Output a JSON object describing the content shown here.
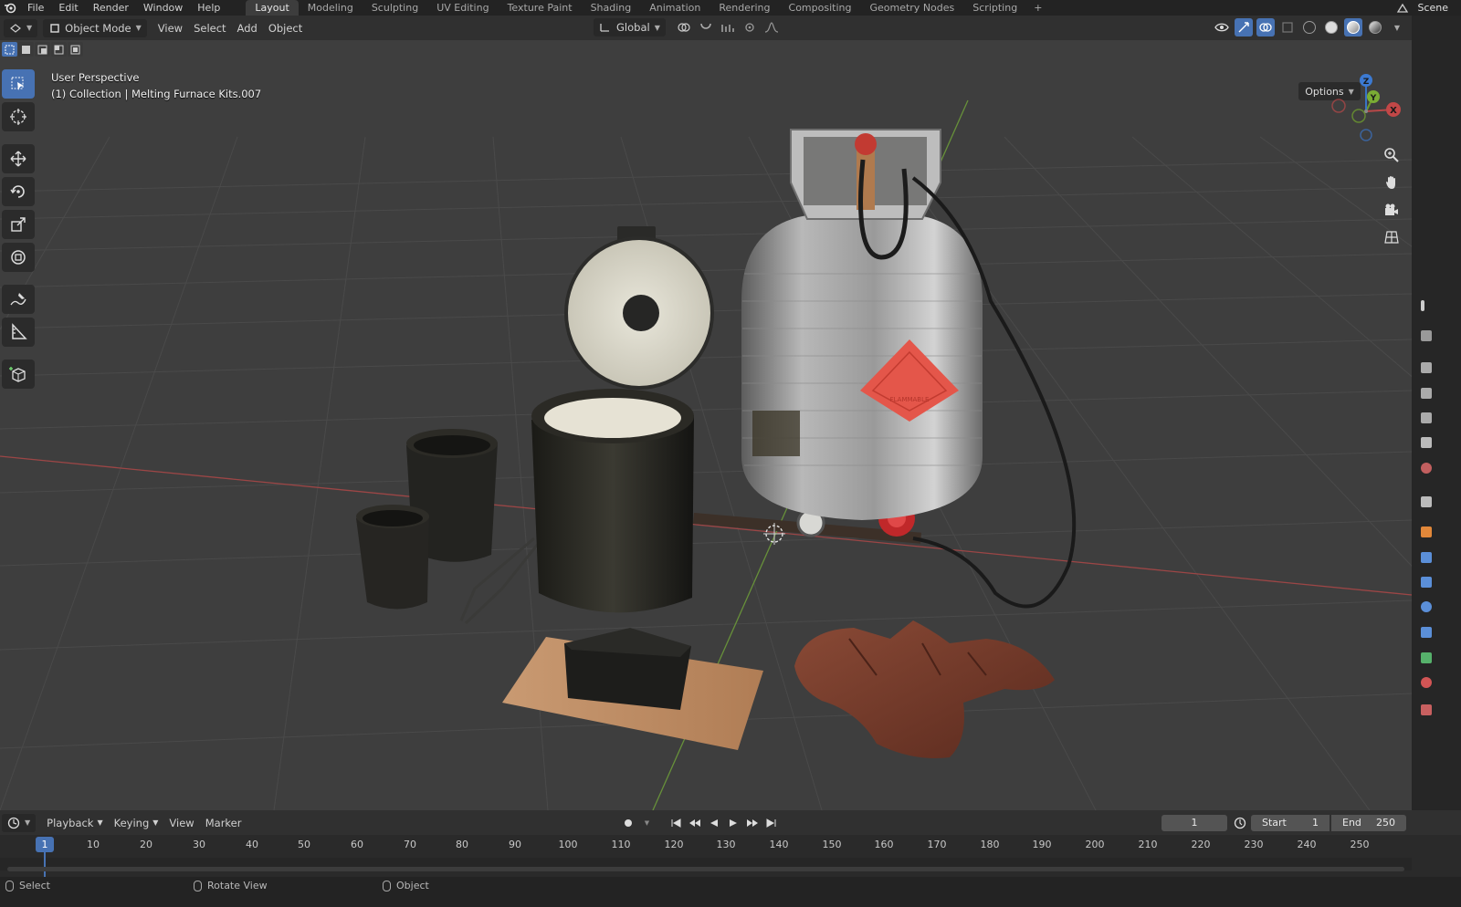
{
  "menubar": {
    "items": [
      "File",
      "Edit",
      "Render",
      "Window",
      "Help"
    ],
    "workspaces": [
      "Layout",
      "Modeling",
      "Sculpting",
      "UV Editing",
      "Texture Paint",
      "Shading",
      "Animation",
      "Rendering",
      "Compositing",
      "Geometry Nodes",
      "Scripting"
    ],
    "active_workspace": "Layout",
    "add_tab": "+",
    "scene": "Scene"
  },
  "viewport_header": {
    "mode": "Object Mode",
    "menus": [
      "View",
      "Select",
      "Add",
      "Object"
    ],
    "transform_orientation": "Global"
  },
  "viewport": {
    "perspective": "User Perspective",
    "collection": "(1) Collection | Melting Furnace Kits.007",
    "options_label": "Options",
    "gizmo_axes": [
      "X",
      "Y",
      "Z"
    ],
    "sign_text": "FLAMMABLE"
  },
  "toolbar": {
    "tools": [
      "select-box-icon",
      "cursor-icon",
      "move-icon",
      "rotate-icon",
      "scale-icon",
      "transform-icon",
      "annotate-icon",
      "measure-icon",
      "add-cube-icon"
    ]
  },
  "timeline": {
    "menus": [
      "Playback",
      "Keying",
      "View",
      "Marker"
    ],
    "current_frame": "1",
    "start_label": "Start",
    "start_value": "1",
    "end_label": "End",
    "end_value": "250",
    "playhead_frame": "1",
    "ticks": [
      "10",
      "20",
      "30",
      "40",
      "50",
      "60",
      "70",
      "80",
      "90",
      "100",
      "110",
      "120",
      "130",
      "140",
      "150",
      "160",
      "170",
      "180",
      "190",
      "200",
      "210",
      "220",
      "230",
      "240",
      "250"
    ]
  },
  "statusbar": {
    "items": [
      "Select",
      "Rotate View",
      "Object"
    ]
  },
  "colors": {
    "accent": "#4772b3",
    "x_axis": "#b84848",
    "y_axis": "#6d9a2e",
    "z_axis": "#3a74c4"
  }
}
